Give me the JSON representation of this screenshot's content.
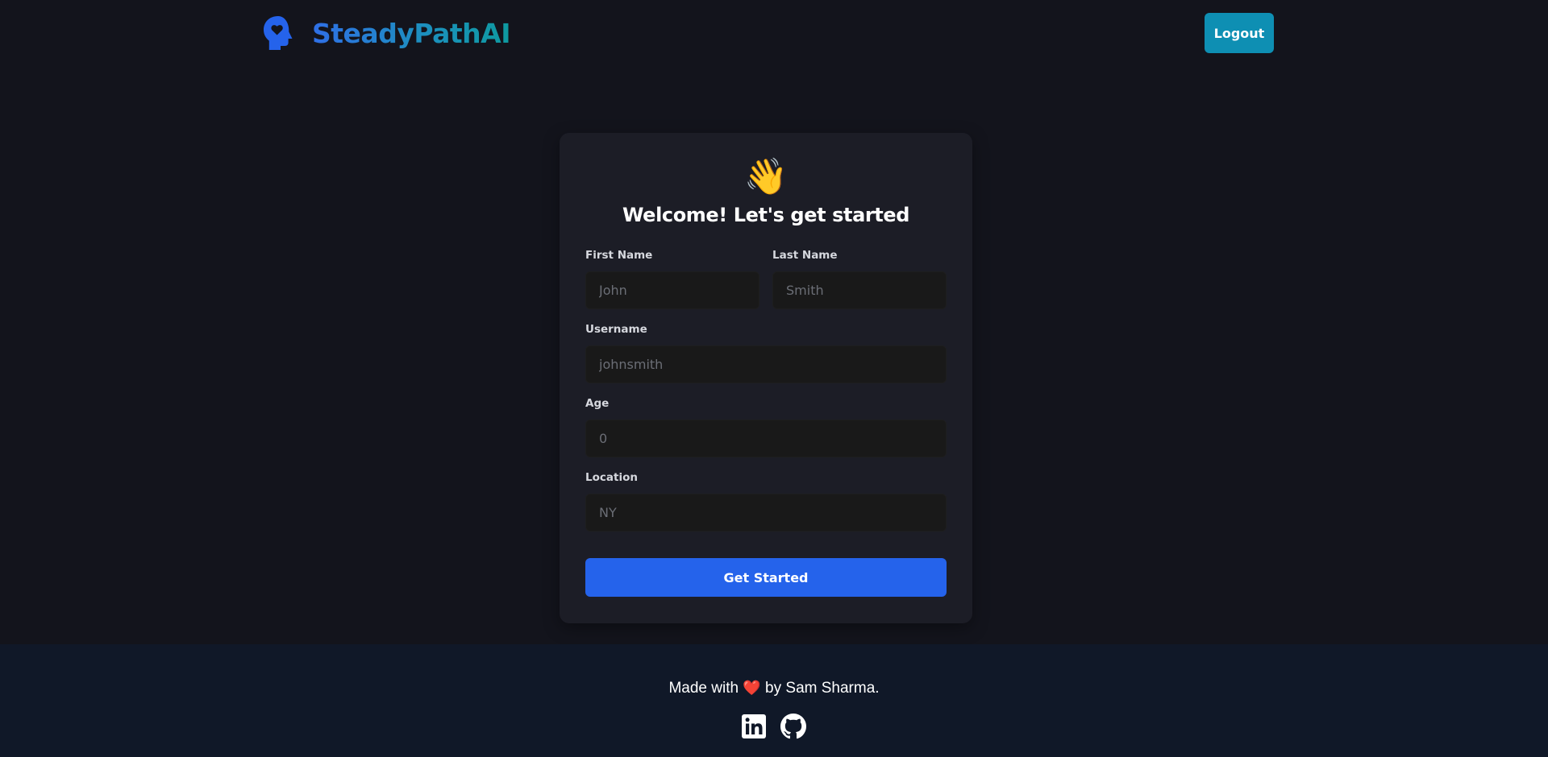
{
  "header": {
    "brand_name": "SteadyPathAI",
    "logout_label": "Logout"
  },
  "card": {
    "wave_emoji": "👋",
    "title": "Welcome! Let's get started",
    "fields": {
      "first_name": {
        "label": "First Name",
        "placeholder": "John",
        "value": ""
      },
      "last_name": {
        "label": "Last Name",
        "placeholder": "Smith",
        "value": ""
      },
      "username": {
        "label": "Username",
        "placeholder": "johnsmith",
        "value": ""
      },
      "age": {
        "label": "Age",
        "placeholder": "0",
        "value": ""
      },
      "location": {
        "label": "Location",
        "placeholder": "NY",
        "value": ""
      }
    },
    "submit_label": "Get Started"
  },
  "footer": {
    "made_with": "Made with",
    "heart": "❤️",
    "by_text": "by Sam Sharma.",
    "social": [
      "linkedin-icon",
      "github-icon"
    ]
  },
  "colors": {
    "background": "#13141c",
    "card": "#1c1d26",
    "input": "#191919",
    "primary_button": "#2563eb",
    "logout_button": "#0e8fb3",
    "brand_gradient_start": "#2f6fe6",
    "brand_gradient_end": "#0e9aa0",
    "footer": "#101828"
  }
}
